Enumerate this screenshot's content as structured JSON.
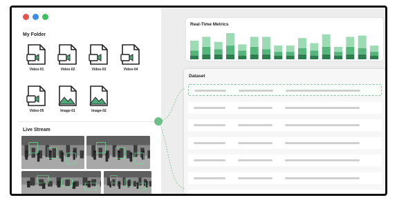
{
  "window": {
    "dots": [
      "#e5534b",
      "#3b8eea",
      "#3fbf5f"
    ]
  },
  "folder": {
    "title": "My Folder",
    "files": [
      {
        "label": "Video-01",
        "icon": "video-file-icon"
      },
      {
        "label": "Video-02",
        "icon": "video-file-icon"
      },
      {
        "label": "Video-03",
        "icon": "video-file-icon"
      },
      {
        "label": "Video-04",
        "icon": "video-file-icon"
      },
      {
        "label": "Video-05",
        "icon": "video-file-icon"
      },
      {
        "label": "Image-01",
        "icon": "image-file-icon"
      },
      {
        "label": "Image-02",
        "icon": "image-file-icon"
      }
    ]
  },
  "live": {
    "title": "Live Stream",
    "feeds": 4
  },
  "metrics": {
    "title": "Real-Time Metrics"
  },
  "chart_data": {
    "type": "bar",
    "stacked": true,
    "colors": [
      "#2e7d4f",
      "#55b67c",
      "#9ddbb4"
    ],
    "values": [
      [
        3,
        4,
        8
      ],
      [
        4,
        6,
        8
      ],
      [
        4,
        4,
        6
      ],
      [
        4,
        7,
        10
      ],
      [
        3,
        4,
        5
      ],
      [
        4,
        6,
        8
      ],
      [
        4,
        4,
        10
      ],
      [
        3,
        3,
        5
      ],
      [
        3,
        3,
        5
      ],
      [
        4,
        5,
        8
      ],
      [
        3,
        4,
        6
      ],
      [
        4,
        6,
        10
      ],
      [
        3,
        3,
        4
      ],
      [
        4,
        6,
        8
      ],
      [
        4,
        5,
        10
      ],
      [
        3,
        3,
        5
      ]
    ]
  },
  "dataset": {
    "title": "Dataset",
    "rows": 7,
    "selected_row": 0
  },
  "colors": {
    "accent": "#4caf72",
    "frame_bg": "#ededed"
  }
}
